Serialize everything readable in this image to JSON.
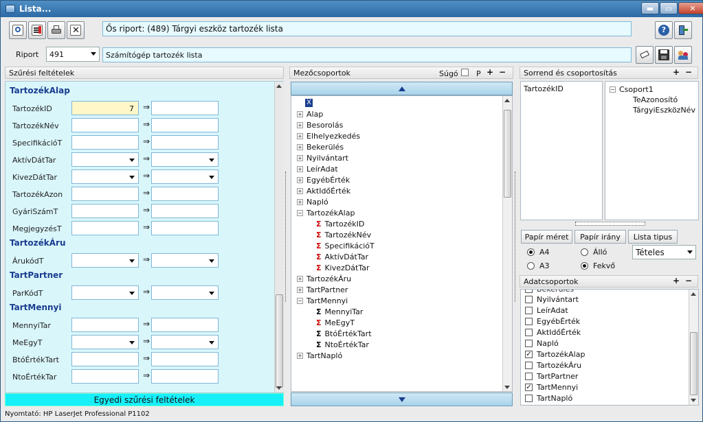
{
  "window": {
    "title": "Lista...",
    "minimize": "▬",
    "maximize": "▭",
    "close": "✕"
  },
  "header": {
    "parent_report": "Ős riport: (489)  Tárgyi eszköz tartozék lista",
    "report_label": "Riport",
    "report_number": "491",
    "report_name": "Számítógép tartozék lista"
  },
  "filter_panel": {
    "title": "Szűrési feltételek",
    "sections": [
      {
        "name": "TartozékAlap",
        "fields": [
          {
            "label": "TartozékID",
            "from": "7",
            "to": "",
            "type": "text"
          },
          {
            "label": "TartozékNév",
            "from": "",
            "to": "",
            "type": "text"
          },
          {
            "label": "SpecifikációT",
            "from": "",
            "to": "",
            "type": "text"
          },
          {
            "label": "AktívDátTar",
            "from": "",
            "to": "",
            "type": "select"
          },
          {
            "label": "KivezDátTar",
            "from": "",
            "to": "",
            "type": "select"
          },
          {
            "label": "TartozékAzon",
            "from": "",
            "to": "",
            "type": "text"
          },
          {
            "label": "GyáriSzámT",
            "from": "",
            "to": "",
            "type": "text"
          },
          {
            "label": "MegjegyzésT",
            "from": "",
            "to": "",
            "type": "text"
          }
        ]
      },
      {
        "name": "TartozékÁru",
        "fields": [
          {
            "label": "ÁrukódT",
            "from": "",
            "to": "",
            "type": "select"
          }
        ]
      },
      {
        "name": "TartPartner",
        "fields": [
          {
            "label": "ParKódT",
            "from": "",
            "to": "",
            "type": "select"
          }
        ]
      },
      {
        "name": "TartMennyi",
        "fields": [
          {
            "label": "MennyiTar",
            "from": "",
            "to": "",
            "type": "text"
          },
          {
            "label": "MeEgyT",
            "from": "",
            "to": "",
            "type": "select"
          },
          {
            "label": "BtóÉrtékTart",
            "from": "",
            "to": "",
            "type": "text"
          },
          {
            "label": "NtoÉrtékTar",
            "from": "",
            "to": "",
            "type": "text"
          }
        ]
      }
    ],
    "range_arrow": "⇒",
    "custom_filter_button": "Egyedi szűrési feltételek"
  },
  "fieldgroups_panel": {
    "title": "Mezőcsoportok",
    "help_label": "Súgó",
    "p_label": "P",
    "plus": "+",
    "minus": "−",
    "root_marker": "X",
    "tree": [
      {
        "label": "Alap",
        "level": 0,
        "expander": "+"
      },
      {
        "label": "Besorolás",
        "level": 0,
        "expander": "+"
      },
      {
        "label": "Elhelyezkedés",
        "level": 0,
        "expander": "+"
      },
      {
        "label": "Bekerülés",
        "level": 0,
        "expander": "+"
      },
      {
        "label": "Nyilvántart",
        "level": 0,
        "expander": "+"
      },
      {
        "label": "LeírAdat",
        "level": 0,
        "expander": "+"
      },
      {
        "label": "EgyébÉrték",
        "level": 0,
        "expander": "+"
      },
      {
        "label": "AktIdőÉrték",
        "level": 0,
        "expander": "+"
      },
      {
        "label": "Napló",
        "level": 0,
        "expander": "+"
      },
      {
        "label": "TartozékAlap",
        "level": 0,
        "expander": "−"
      },
      {
        "label": "TartozékID",
        "level": 1,
        "mark": "X"
      },
      {
        "label": "TartozékNév",
        "level": 1,
        "mark": "X"
      },
      {
        "label": "SpecifikációT",
        "level": 1,
        "mark": "X"
      },
      {
        "label": "AktívDátTar",
        "level": 1,
        "mark": "X"
      },
      {
        "label": "KivezDátTar",
        "level": 1,
        "mark": "X"
      },
      {
        "label": "TartozékÁru",
        "level": 0,
        "expander": "+"
      },
      {
        "label": "TartPartner",
        "level": 0,
        "expander": "+"
      },
      {
        "label": "TartMennyi",
        "level": 0,
        "expander": "−"
      },
      {
        "label": "MennyiTar",
        "level": 1,
        "mark": "Σ"
      },
      {
        "label": "MeEgyT",
        "level": 1,
        "mark": "X"
      },
      {
        "label": "BtóÉrtékTart",
        "level": 1,
        "mark": "Σ"
      },
      {
        "label": "NtoÉrtékTar",
        "level": 1,
        "mark": "Σ"
      },
      {
        "label": "TartNapló",
        "level": 0,
        "expander": "+"
      }
    ]
  },
  "sort_panel": {
    "title": "Sorrend és csoportosítás",
    "sort_items": [
      "TartozékID"
    ],
    "group_root": "Csoport1",
    "group_expander": "−",
    "group_items": [
      "TeAzonosító",
      "TárgyiEszközNév"
    ]
  },
  "paper": {
    "size_button": "Papír méret",
    "orientation_button": "Papír irány",
    "list_type_button": "Lista tipus",
    "size_options": [
      {
        "label": "A4",
        "selected": true
      },
      {
        "label": "A3",
        "selected": false
      }
    ],
    "orientation_options": [
      {
        "label": "Álló",
        "selected": false
      },
      {
        "label": "Fekvő",
        "selected": true
      }
    ],
    "list_type_value": "Tételes"
  },
  "datagroups_panel": {
    "title": "Adatcsoportok",
    "partial_item": "Bekerülés",
    "items": [
      {
        "label": "Nyilvántart",
        "checked": false
      },
      {
        "label": "LeírAdat",
        "checked": false
      },
      {
        "label": "EgyébÉrték",
        "checked": false
      },
      {
        "label": "AktIdőÉrték",
        "checked": false
      },
      {
        "label": "Napló",
        "checked": false
      },
      {
        "label": "TartozékAlap",
        "checked": true
      },
      {
        "label": "TartozékÁru",
        "checked": false
      },
      {
        "label": "TartPartner",
        "checked": false
      },
      {
        "label": "TartMennyi",
        "checked": true
      },
      {
        "label": "TartNapló",
        "checked": false
      }
    ],
    "check_mark": "✓"
  },
  "status": {
    "printer": "Nyomtató: HP LaserJet Professional P1102"
  },
  "colors": {
    "filter_bg": "#d9f6fb",
    "custom_filter_bg": "#17f0fb",
    "highlight_field": "#fff7c8",
    "section_text": "#1a3d8f",
    "titlebar": "#2c6aa6"
  }
}
